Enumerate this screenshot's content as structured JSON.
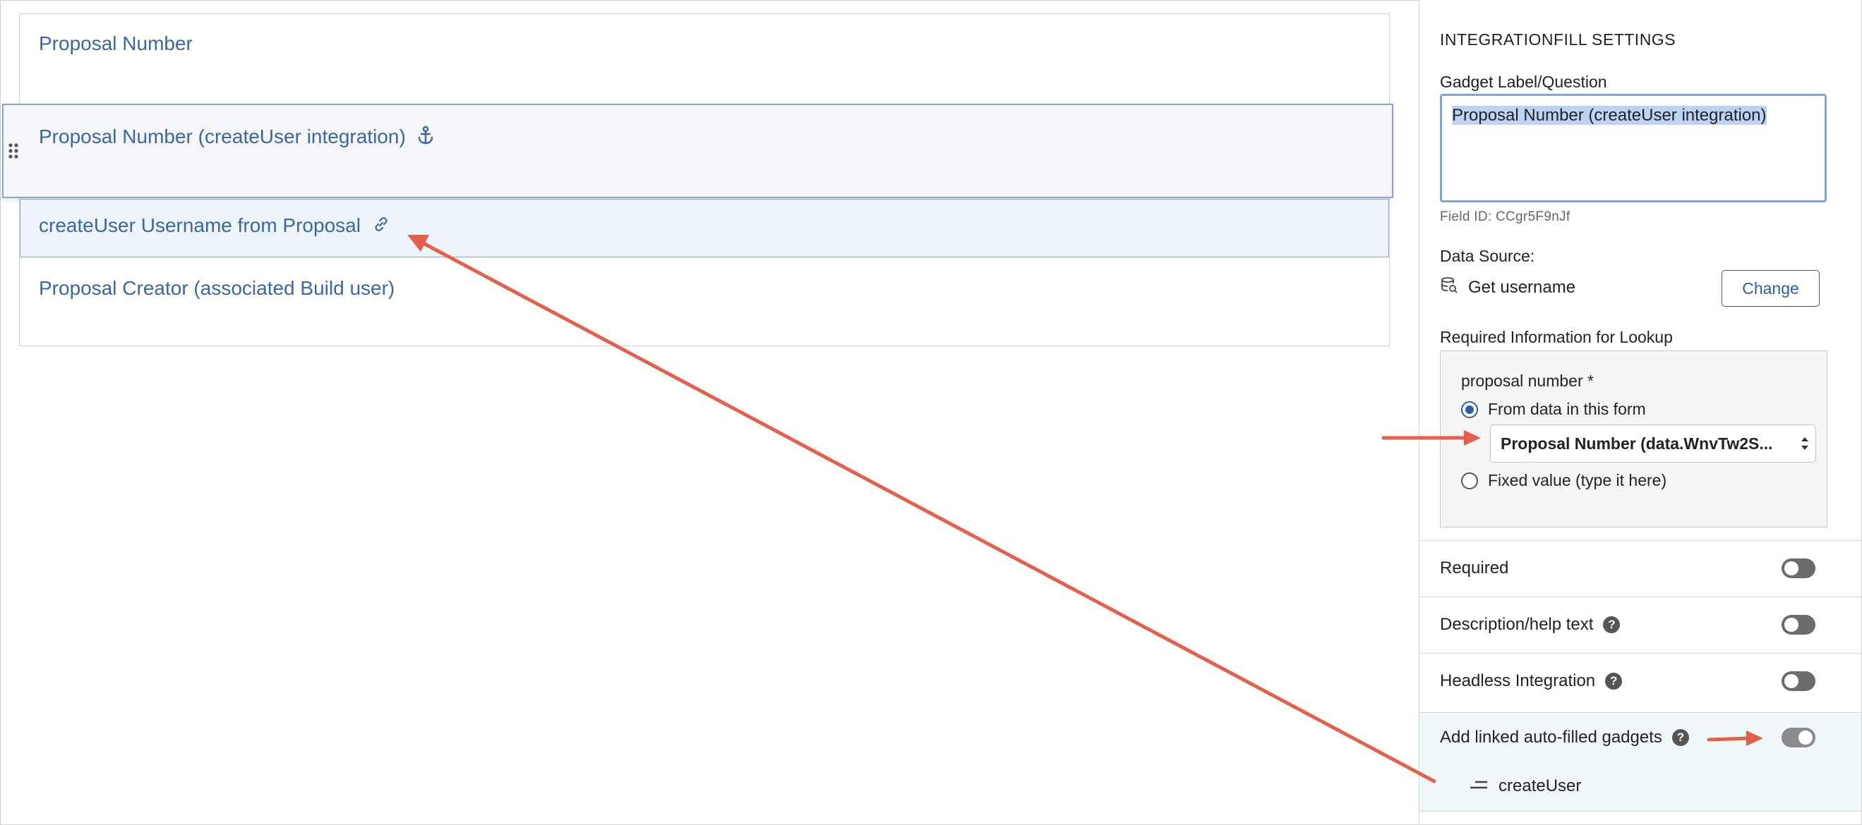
{
  "canvas": {
    "gadgets": [
      {
        "label": "Proposal Number"
      },
      {
        "label": "Proposal Number (createUser integration)",
        "icon": "anchor-icon"
      },
      {
        "label": "createUser Username from Proposal",
        "icon": "link-icon"
      },
      {
        "label": "Proposal Creator (associated Build user)"
      }
    ]
  },
  "panel": {
    "title": "INTEGRATIONFILL SETTINGS",
    "label_question": "Gadget Label/Question",
    "label_value": "Proposal Number (createUser integration)",
    "field_id": "Field ID: CCgr5F9nJf",
    "data_source_label": "Data Source:",
    "data_source_value": "Get username",
    "change_label": "Change",
    "lookup_heading": "Required Information for Lookup",
    "lookup": {
      "field_label": "proposal number *",
      "option_from_form": "From data in this form",
      "select_value": "Proposal Number (data.WnvTw2S...",
      "option_fixed": "Fixed value (type it here)"
    },
    "toggles": [
      {
        "label": "Required",
        "help": false,
        "on": false
      },
      {
        "label": "Description/help text",
        "help": true,
        "on": false
      },
      {
        "label": "Headless Integration",
        "help": true,
        "on": false
      },
      {
        "label": "Add linked auto-filled gadgets",
        "help": true,
        "on": true
      }
    ],
    "linked_item": "createUser"
  },
  "colors": {
    "accent": "#2f5e9e",
    "link_text": "#3a66a3",
    "annotation_arrow": "#e5604a"
  }
}
